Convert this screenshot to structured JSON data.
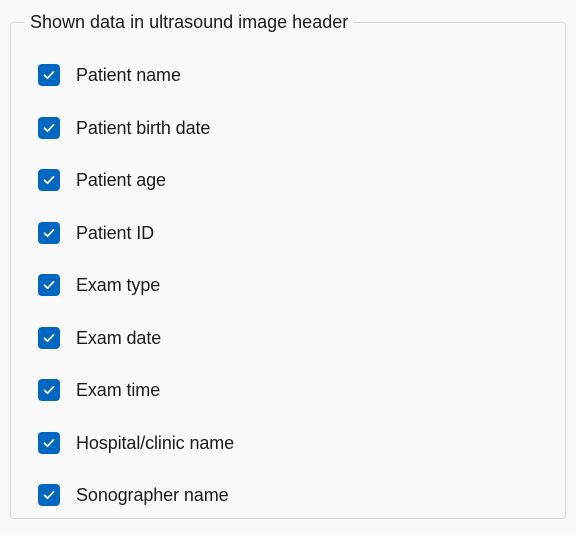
{
  "group": {
    "title": "Shown data in ultrasound image header"
  },
  "options": [
    {
      "label": "Patient name",
      "checked": true
    },
    {
      "label": "Patient birth date",
      "checked": true
    },
    {
      "label": "Patient age",
      "checked": true
    },
    {
      "label": "Patient ID",
      "checked": true
    },
    {
      "label": "Exam type",
      "checked": true
    },
    {
      "label": "Exam date",
      "checked": true
    },
    {
      "label": "Exam time",
      "checked": true
    },
    {
      "label": "Hospital/clinic name",
      "checked": true
    },
    {
      "label": "Sonographer name",
      "checked": true
    }
  ],
  "icons": {
    "checkbox": "checkmark-icon"
  },
  "colors": {
    "checkbox_fill": "#0067c0",
    "checkmark": "#ffffff",
    "text": "#1a1a1a",
    "background": "#f9f9f9",
    "group_border": "#d9d9d9"
  }
}
